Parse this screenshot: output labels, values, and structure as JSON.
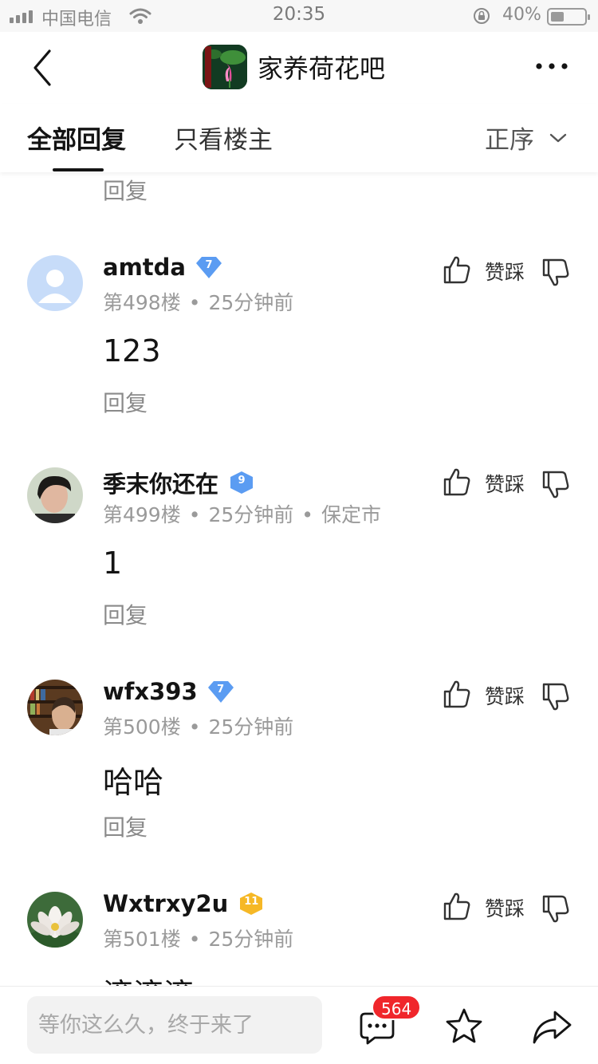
{
  "status_bar": {
    "carrier": "中国电信",
    "time": "20:35",
    "battery_text": "40%",
    "battery_level": 0.4
  },
  "header": {
    "forum_name": "家养荷花吧",
    "forum_avatar_text": "家养荷花"
  },
  "tabs": {
    "all_replies": "全部回复",
    "owner_only": "只看楼主",
    "sort": "正序"
  },
  "top_reply_label": "回复",
  "posts": [
    {
      "username": "amtda",
      "level": "7",
      "level_color": "#5b9cf2",
      "floor": "第498楼",
      "time": "25分钟前",
      "location": "",
      "text": "123",
      "reply": "回复",
      "agree": "赞踩",
      "avatar": "default-avatar"
    },
    {
      "username": "季末你还在",
      "level": "9",
      "level_color": "#5b9cf2",
      "floor": "第499楼",
      "time": "25分钟前",
      "location": "保定市",
      "text": "1",
      "reply": "回复",
      "agree": "赞踩",
      "avatar": "photo-person"
    },
    {
      "username": "wfx393",
      "level": "7",
      "level_color": "#5b9cf2",
      "floor": "第500楼",
      "time": "25分钟前",
      "location": "",
      "text": "哈哈",
      "reply": "回复",
      "agree": "赞踩",
      "avatar": "photo-bookshelf"
    },
    {
      "username": "Wxtrxy2u",
      "level": "11",
      "level_color": "#f6b826",
      "floor": "第501楼",
      "time": "25分钟前",
      "location": "",
      "text": "滚滚滚",
      "reply": "回复",
      "agree": "赞踩",
      "avatar": "photo-lotus"
    }
  ],
  "bottom_bar": {
    "placeholder": "等你这么久，终于来了",
    "comment_count": "564",
    "badge_color": "#f0262b"
  }
}
